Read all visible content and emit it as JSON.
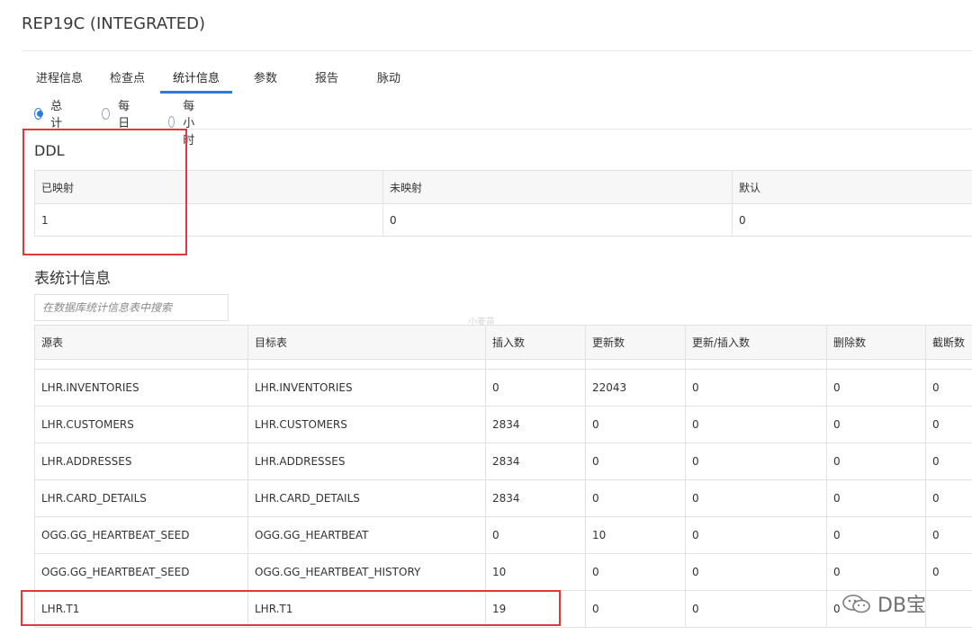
{
  "app_title": "REP19C (INTEGRATED)",
  "tabs": [
    {
      "label": "进程信息"
    },
    {
      "label": "检查点"
    },
    {
      "label": "统计信息",
      "active": true
    },
    {
      "label": "参数"
    },
    {
      "label": "报告"
    },
    {
      "label": "脉动"
    }
  ],
  "radios": [
    {
      "label": "总计",
      "selected": true
    },
    {
      "label": "每日",
      "selected": false
    },
    {
      "label": "每小时",
      "selected": false
    }
  ],
  "ddl": {
    "title": "DDL",
    "headers": [
      "已映射",
      "未映射",
      "默认"
    ],
    "values": [
      "1",
      "0",
      "0"
    ]
  },
  "table_stats": {
    "title": "表统计信息",
    "search_placeholder": "在数据库统计信息表中搜索",
    "headers": [
      "源表",
      "目标表",
      "插入数",
      "更新数",
      "更新/插入数",
      "删除数",
      "截断数"
    ],
    "rows": [
      [
        "LHR.INVENTORIES",
        "LHR.INVENTORIES",
        "0",
        "22043",
        "0",
        "0",
        "0"
      ],
      [
        "LHR.CUSTOMERS",
        "LHR.CUSTOMERS",
        "2834",
        "0",
        "0",
        "0",
        "0"
      ],
      [
        "LHR.ADDRESSES",
        "LHR.ADDRESSES",
        "2834",
        "0",
        "0",
        "0",
        "0"
      ],
      [
        "LHR.CARD_DETAILS",
        "LHR.CARD_DETAILS",
        "2834",
        "0",
        "0",
        "0",
        "0"
      ],
      [
        "OGG.GG_HEARTBEAT_SEED",
        "OGG.GG_HEARTBEAT",
        "0",
        "10",
        "0",
        "0",
        "0"
      ],
      [
        "OGG.GG_HEARTBEAT_SEED",
        "OGG.GG_HEARTBEAT_HISTORY",
        "10",
        "0",
        "0",
        "0",
        "0"
      ],
      [
        "LHR.T1",
        "LHR.T1",
        "19",
        "0",
        "0",
        "0",
        ""
      ]
    ]
  },
  "watermark_small": "小麦苗",
  "logo_text": "DB宝",
  "highlight_color": "#e0393b",
  "accent_color": "#2b7bd8"
}
